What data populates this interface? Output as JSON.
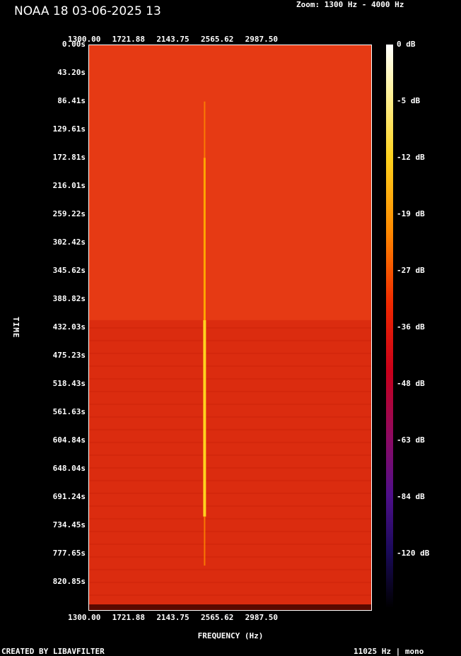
{
  "title": "NOAA 18 03-06-2025 13",
  "zoom": "Zoom: 1300 Hz - 4000 Hz",
  "footer_left": "CREATED BY LIBAVFILTER",
  "footer_right": "11025 Hz | mono",
  "chart_data": {
    "type": "heatmap",
    "xlabel": "FREQUENCY (Hz)",
    "ylabel": "TIME",
    "xlim": [
      1300,
      4000
    ],
    "ylim": [
      0,
      864
    ],
    "x_ticks": [
      "1300.00",
      "1721.88",
      "2143.75",
      "2565.62",
      "2987.50"
    ],
    "y_ticks": [
      "0.00s",
      "43.20s",
      "86.41s",
      "129.61s",
      "172.81s",
      "216.01s",
      "259.22s",
      "302.42s",
      "345.62s",
      "388.82s",
      "432.03s",
      "475.23s",
      "518.43s",
      "561.63s",
      "604.84s",
      "648.04s",
      "691.24s",
      "734.45s",
      "777.65s",
      "820.85s"
    ],
    "colorbar_ticks": [
      "0 dB",
      "-5 dB",
      "-12 dB",
      "-19 dB",
      "-27 dB",
      "-36 dB",
      "-48 dB",
      "-63 dB",
      "-84 dB",
      "-120 dB"
    ],
    "colors": {
      "background_noise": "#e63a14",
      "darker_band": "#d82a0e",
      "signal": "#ffd21e"
    },
    "signal": {
      "frequency_hz": 2400,
      "time_start_s": 86,
      "time_end_s": 795,
      "strong_start_s": 420,
      "strong_end_s": 720
    },
    "darker_band_start_s": 420
  }
}
